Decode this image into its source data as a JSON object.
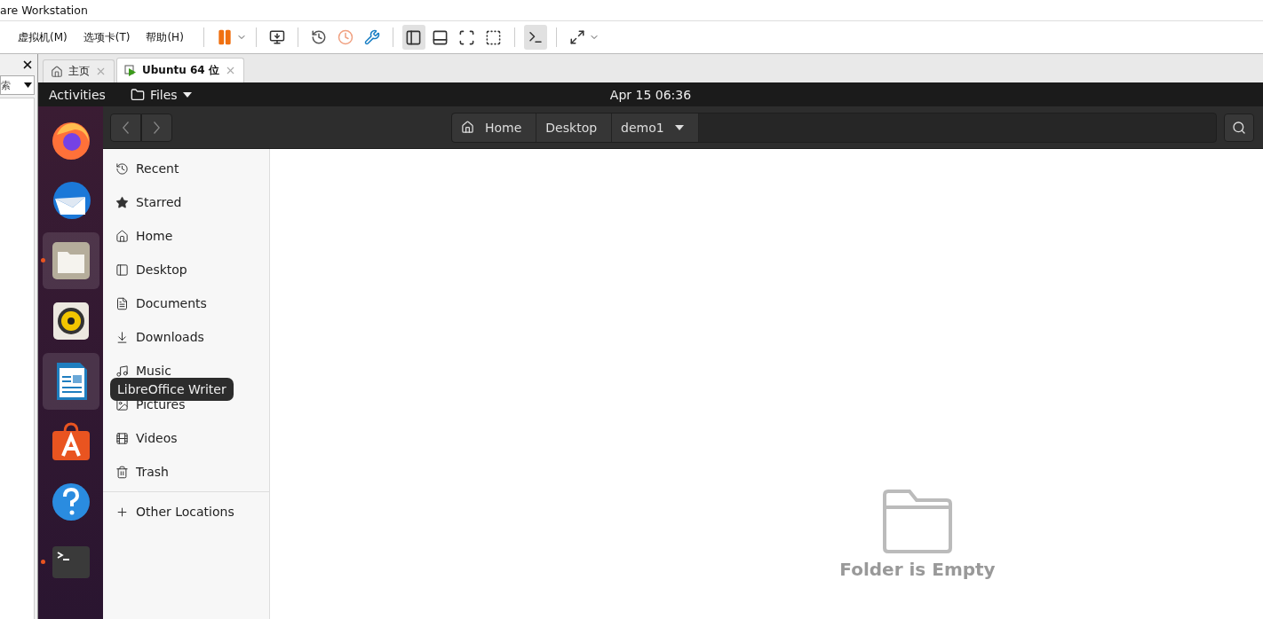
{
  "window": {
    "title": "are Workstation"
  },
  "menu": [
    {
      "label": "虚拟机(M)"
    },
    {
      "label": "选项卡(T)"
    },
    {
      "label": "帮助(H)"
    }
  ],
  "toolbar": {
    "view_buttons": [
      {
        "selected": true
      },
      {
        "selected": false
      },
      {
        "selected": false
      },
      {
        "selected": false
      }
    ],
    "console_selected": true
  },
  "library": {
    "search": {
      "value": "索"
    }
  },
  "tabs": [
    {
      "label": "主页",
      "selected": false
    },
    {
      "label": "Ubuntu 64 位",
      "selected": true
    }
  ],
  "topbar": {
    "activities": "Activities",
    "app": "Files",
    "clock": "Apr 15  06:36"
  },
  "dock": [
    {
      "running": false,
      "highlighted": false
    },
    {
      "running": false,
      "highlighted": false
    },
    {
      "running": true,
      "highlighted": true
    },
    {
      "running": false,
      "highlighted": false
    },
    {
      "running": false,
      "highlighted": true
    },
    {
      "running": false,
      "highlighted": false
    },
    {
      "running": false,
      "highlighted": false
    },
    {
      "running": true,
      "highlighted": false
    }
  ],
  "tooltip": "LibreOffice Writer",
  "path": [
    {
      "label": "Home",
      "kind": "home"
    },
    {
      "label": "Desktop",
      "kind": "folder"
    },
    {
      "label": "demo1",
      "kind": "current"
    }
  ],
  "sidebar": [
    {
      "kind": "recent",
      "label": "Recent"
    },
    {
      "kind": "starred",
      "label": "Starred"
    },
    {
      "kind": "home",
      "label": "Home"
    },
    {
      "kind": "desktop",
      "label": "Desktop"
    },
    {
      "kind": "documents",
      "label": "Documents"
    },
    {
      "kind": "downloads",
      "label": "Downloads"
    },
    {
      "kind": "music",
      "label": "Music"
    },
    {
      "kind": "pictures",
      "label": "Pictures"
    },
    {
      "kind": "videos",
      "label": "Videos"
    },
    {
      "kind": "trash",
      "label": "Trash"
    },
    {
      "kind": "other",
      "label": "Other Locations"
    }
  ],
  "empty": {
    "message": "Folder is Empty"
  }
}
